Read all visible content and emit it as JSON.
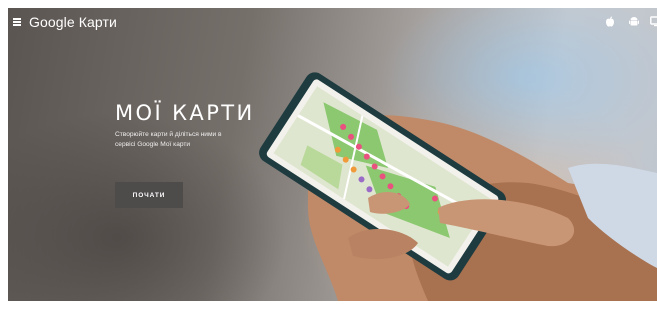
{
  "header": {
    "brand": "Google Карти",
    "menu_icon": "hamburger-menu-icon",
    "platform_icons": [
      "apple-icon",
      "android-icon",
      "desktop-icon"
    ]
  },
  "hero": {
    "title": "МОЇ КАРТИ",
    "description": "Створюйте карти й діліться ними в сервісі Google Мої карти",
    "cta_label": "ПОЧАТИ"
  },
  "colors": {
    "text": "#ffffff",
    "button_bg": "#4e4b4b",
    "map_green": "#8bc870",
    "map_pink": "#e9527f"
  }
}
